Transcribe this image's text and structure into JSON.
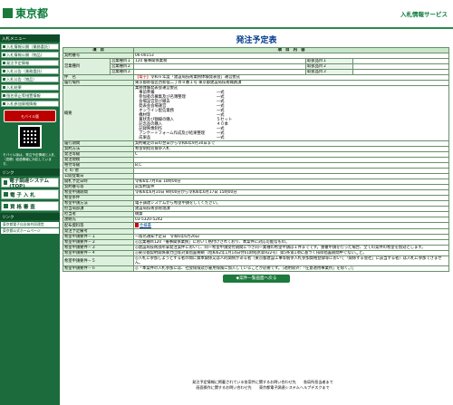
{
  "header": {
    "logo_text": "東京都",
    "system_title": "入札情報サービス"
  },
  "sidebar": {
    "section_menu": "入札メニュー",
    "items": [
      {
        "label": "入札情報公開（業務委託）"
      },
      {
        "label": "入札情報公開（物品）"
      },
      {
        "label": "発注予定情報"
      },
      {
        "label": "入札公告（業務委託）"
      },
      {
        "label": "入札公告（物品）"
      },
      {
        "label": "入札結果"
      },
      {
        "label": "指名停止等措置情報"
      },
      {
        "label": "入札参加資格情報"
      }
    ],
    "mobile_label": "モバイル版",
    "mobile_note": "モバイル版は、発注予定情報と入札（見積）経過情報に対応しています。",
    "section_link": "リンク",
    "big_items": [
      {
        "label": "電子調達システム(TOP)"
      },
      {
        "label": "電 子 入 札"
      },
      {
        "label": "資 格 審 査"
      }
    ],
    "links_head": "リンク",
    "links": [
      {
        "label": "東京都電子自治体共同運営"
      },
      {
        "label": "東京都公式ホームページ"
      }
    ]
  },
  "main": {
    "title": "発注予定表",
    "col_item": "項　目",
    "col_content": "項　目　内　容",
    "contract_no_label": "契約番号",
    "contract_no": "06-00153",
    "business_label": "営業種目",
    "business_rows": [
      {
        "name": "営業種目１",
        "value": "120 催事関係業務",
        "grade_name": "取扱品目１",
        "grade": ""
      },
      {
        "name": "営業種目２",
        "value": "",
        "grade_name": "取扱品目２",
        "grade": ""
      },
      {
        "name": "営業種目３",
        "value": "",
        "grade_name": "取扱品目３",
        "grade": ""
      }
    ],
    "name_label": "件　名",
    "name_tag": "【電子】",
    "name_value": "令和６年度「建設局技術業務体験発表会」運営委託",
    "place_label": "履行場所",
    "place_value": "東京都新宿区西新宿二丁目８番１号 東京都建設局技術職員課",
    "summary_label": "概要",
    "summary_lines": [
      {
        "item": "業務体験発表会運営委託",
        "qty": ""
      },
      {
        "item": "　事前準備",
        "qty": "一式"
      },
      {
        "item": "　参加者の募集及び名簿整理",
        "qty": "一式"
      },
      {
        "item": "　会場設営及び撤去",
        "qty": "一式"
      },
      {
        "item": "　発表会会場運営",
        "qty": "一式"
      },
      {
        "item": "　オンライン配信業務",
        "qty": "一式"
      },
      {
        "item": "　機材等",
        "qty": "一式"
      },
      {
        "item": "　賞状及び額縁の購入",
        "qty": "５セット"
      },
      {
        "item": "　記念品の購入",
        "qty": "４０本"
      },
      {
        "item": "　記録映像制作",
        "qty": "一式"
      },
      {
        "item": "　アンケートフォーム作成及び結果整理",
        "qty": "一式"
      },
      {
        "item": "　成果品",
        "qty": "一式"
      }
    ],
    "rows": [
      {
        "label": "履行期間",
        "value": "契約確定の日の翌日から令和6年9月30日まで"
      },
      {
        "label": "契約方法",
        "value": "希望制指名競争入札"
      },
      {
        "label": "発注等級",
        "value": "C"
      },
      {
        "label": "発注規模",
        "value": ""
      },
      {
        "label": "格付等級",
        "value": "B,C"
      },
      {
        "label": "そ の 他",
        "value": ""
      },
      {
        "label": "公開登載日",
        "value": ""
      },
      {
        "label": "開札予定日時",
        "value": "令和6年7月4日 10時00分"
      },
      {
        "label": "契約番号等",
        "value": "前契約案件"
      },
      {
        "label": "希望申請期間",
        "value": "令和6年6月10日 9時00分から令和6年6月17日 15時00分"
      },
      {
        "label": "希望条件",
        "value": ""
      },
      {
        "label": "希望申請方法",
        "value": "電子調達システムから希望申請をしてください。"
      },
      {
        "label": "担当局部課",
        "value": "建設局技術部管理課"
      },
      {
        "label": "担当者",
        "value": "橋賀"
      },
      {
        "label": "連絡先",
        "value": "03-5320-5242"
      },
      {
        "label": "配布資料等",
        "value": "仕様書"
      },
      {
        "label": "発注予定備考",
        "value": ""
      },
      {
        "label": "希望申請要件－１",
        "value": "一般名通知予定日　令和6年6月26日"
      },
      {
        "label": "希望申請要件－２",
        "value": "◎営業種目120「催事関係業務」において格付けされており、本案件に対応可能なもの。"
      },
      {
        "label": "希望申請要件－３",
        "value": "◎建設局技術部所掌発注案件において、同一希望申請受付期間につき同一業種の希望申請は１件までです。重複申請を行った場合、全ての案件の希望を無効とします。"
      },
      {
        "label": "希望申請要件－４",
        "value": "◎東京都契約関係暴力団等対策措置要綱（昭和62年1月14日付61財経庶第922号）第5条第1項に基づく排除措置期間中でないこと。"
      },
      {
        "label": "希望申請要件－５",
        "value": "◎入札に参加しようとする者の間に資本関係又は人的関係がある者（東京都建設工事等競争入札参加資格登録等において「関係する会社」に該当する者）は入札に参加できません。"
      },
      {
        "label": "希望申請要件－６",
        "value": "◎「本案件の入札参加には、社会保険及び雇用保険に加入していることが必要です。（適用除外：「任意適用事業所」を除く。）」"
      }
    ],
    "list_button": "◆案件一覧画面へ戻る"
  },
  "footer": {
    "line1": "発注予定情報に掲載されている各案件に関するお問い合わせ先　　各局所担当者まで",
    "line2": "画面操作に関するお問い合わせ先　　東京都電子調達システムヘルプデスクまで"
  }
}
